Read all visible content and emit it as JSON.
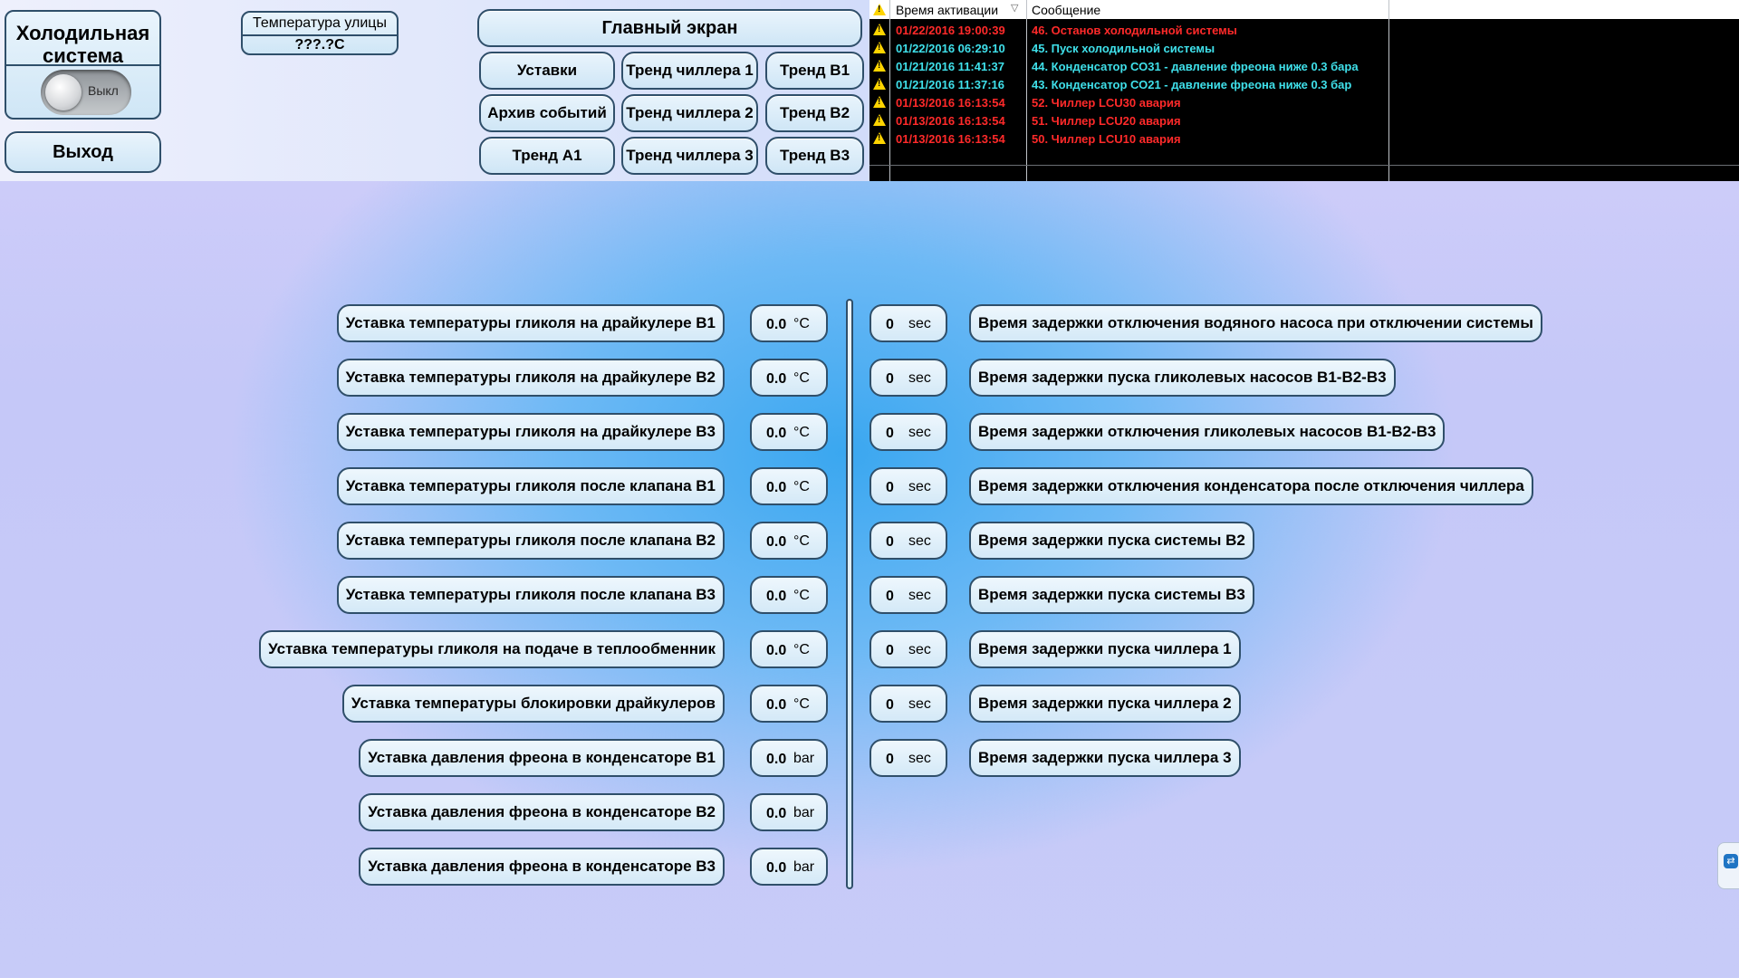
{
  "header": {
    "system_title": "Холодильная система",
    "toggle_label": "Выкл",
    "exit_label": "Выход",
    "outdoor_temp_label": "Температура улицы",
    "outdoor_temp_value": "???.?C",
    "main_screen": "Главный экран",
    "nav": [
      "Уставки",
      "Тренд чиллера 1",
      "Тренд B1",
      "Архив событий",
      "Тренд чиллера 2",
      "Тренд B2",
      "Тренд А1",
      "Тренд чиллера 3",
      "Тренд B3"
    ]
  },
  "alarms": {
    "col_time": "Время активации",
    "col_message": "Сообщение",
    "rows": [
      {
        "time": "01/22/2016 19:00:39",
        "message": "46.   Останов холодильной системы",
        "color": "#ff2a2a"
      },
      {
        "time": "01/22/2016 06:29:10",
        "message": "45.   Пуск холодильной системы",
        "color": "#3fe0ea"
      },
      {
        "time": "01/21/2016 11:41:37",
        "message": "44.   Конденсатор СО31 - давление фреона ниже 0.3 бара",
        "color": "#3fe0ea"
      },
      {
        "time": "01/21/2016 11:37:16",
        "message": "43.   Конденсатор СО21 - давление фреона ниже 0.3 бар",
        "color": "#3fe0ea"
      },
      {
        "time": "01/13/2016 16:13:54",
        "message": "52.   Чиллер LCU30 авария",
        "color": "#ff2a2a"
      },
      {
        "time": "01/13/2016 16:13:54",
        "message": "51.   Чиллер LCU20 авария",
        "color": "#ff2a2a"
      },
      {
        "time": "01/13/2016 16:13:54",
        "message": "50.   Чиллер LCU10 авария",
        "color": "#ff2a2a"
      }
    ]
  },
  "setpoints": [
    {
      "label": "Уставка температуры гликоля на драйкулере B1",
      "value": "0.0",
      "unit": "°C"
    },
    {
      "label": "Уставка температуры гликоля на драйкулере B2",
      "value": "0.0",
      "unit": "°C"
    },
    {
      "label": "Уставка температуры гликоля на драйкулере B3",
      "value": "0.0",
      "unit": "°C"
    },
    {
      "label": "Уставка температуры гликоля после клапана B1",
      "value": "0.0",
      "unit": "°C"
    },
    {
      "label": "Уставка температуры гликоля после клапана B2",
      "value": "0.0",
      "unit": "°C"
    },
    {
      "label": "Уставка температуры гликоля после клапана B3",
      "value": "0.0",
      "unit": "°C"
    },
    {
      "label": "Уставка температуры гликоля на подаче в теплообменник",
      "value": "0.0",
      "unit": "°C"
    },
    {
      "label": "Уставка температуры блокировки драйкулеров",
      "value": "0.0",
      "unit": "°C"
    },
    {
      "label": "Уставка давления фреона в конденсаторе B1",
      "value": "0.0",
      "unit": "bar"
    },
    {
      "label": "Уставка давления фреона в конденсаторе B2",
      "value": "0.0",
      "unit": "bar"
    },
    {
      "label": "Уставка давления фреона в конденсаторе B3",
      "value": "0.0",
      "unit": "bar"
    }
  ],
  "delays": [
    {
      "label": "Время задержки отключения водяного насоса при отключении системы",
      "value": "0",
      "unit": "sec"
    },
    {
      "label": "Время задержки пуска гликолевых насосов B1-B2-B3",
      "value": "0",
      "unit": "sec"
    },
    {
      "label": "Время задержки отключения гликолевых насосов B1-B2-B3",
      "value": "0",
      "unit": "sec"
    },
    {
      "label": "Время задержки отключения конденсатора после отключения чиллера",
      "value": "0",
      "unit": "sec"
    },
    {
      "label": "Время задержки пуска системы B2",
      "value": "0",
      "unit": "sec"
    },
    {
      "label": "Время задержки пуска системы B3",
      "value": "0",
      "unit": "sec"
    },
    {
      "label": "Время задержки пуска чиллера 1",
      "value": "0",
      "unit": "sec"
    },
    {
      "label": "Время задержки пуска чиллера 2",
      "value": "0",
      "unit": "sec"
    },
    {
      "label": "Время задержки пуска чиллера 3",
      "value": "0",
      "unit": "sec"
    }
  ],
  "colors": {
    "alarm_red": "#ff2a2a",
    "alarm_cyan": "#3fe0ea",
    "border": "#2f4f6a"
  }
}
